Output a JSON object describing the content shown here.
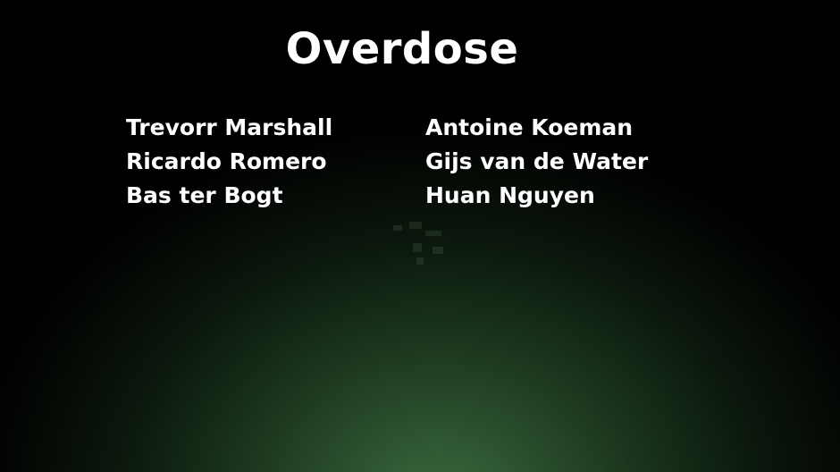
{
  "title": "Overdose",
  "credits": {
    "left": [
      "Trevorr Marshall",
      "Ricardo Romero",
      "Bas ter Bogt"
    ],
    "right": [
      "Antoine Koeman",
      "Gijs van de Water",
      "Huan Nguyen"
    ]
  },
  "colors": {
    "background_center": "#3a6a3c",
    "background_edge": "#000000",
    "text": "#ffffff"
  }
}
